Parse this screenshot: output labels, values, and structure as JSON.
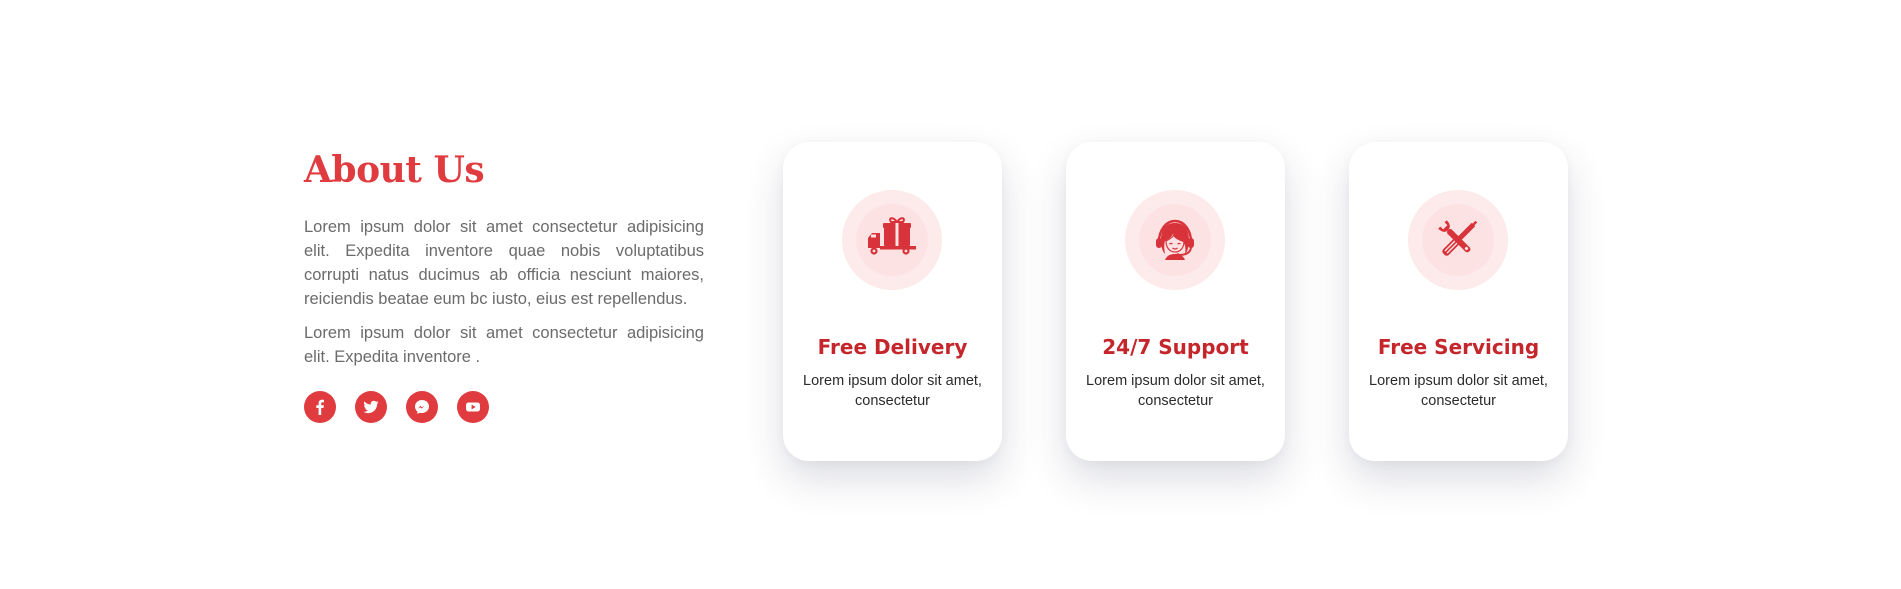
{
  "colors": {
    "accent": "#e03b3f",
    "card_title": "#c4262b",
    "badge_outer": "#fdeaea",
    "badge_inner": "#fde2e3",
    "body_text": "#6b6b6b"
  },
  "about": {
    "title": "About Us",
    "paragraph_1": "Lorem ipsum dolor sit amet consectetur adipisicing elit. Expedita inventore quae nobis voluptatibus corrupti natus ducimus ab officia nesciunt maiores, reiciendis beatae eum bc iusto, eius est repellendus.",
    "paragraph_2": "Lorem ipsum dolor sit amet consectetur adipisicing elit. Expedita inventore .",
    "socials": [
      {
        "icon": "facebook-icon"
      },
      {
        "icon": "twitter-icon"
      },
      {
        "icon": "messenger-icon"
      },
      {
        "icon": "youtube-icon"
      }
    ]
  },
  "features": [
    {
      "icon": "delivery-truck-gift-icon",
      "title": "Free Delivery",
      "text": "Lorem ipsum dolor sit amet, consectetur"
    },
    {
      "icon": "support-headset-icon",
      "title": "24/7 Support",
      "text": "Lorem ipsum dolor sit amet, consectetur"
    },
    {
      "icon": "wrench-screwdriver-icon",
      "title": "Free Servicing",
      "text": "Lorem ipsum dolor sit amet, consectetur"
    }
  ]
}
